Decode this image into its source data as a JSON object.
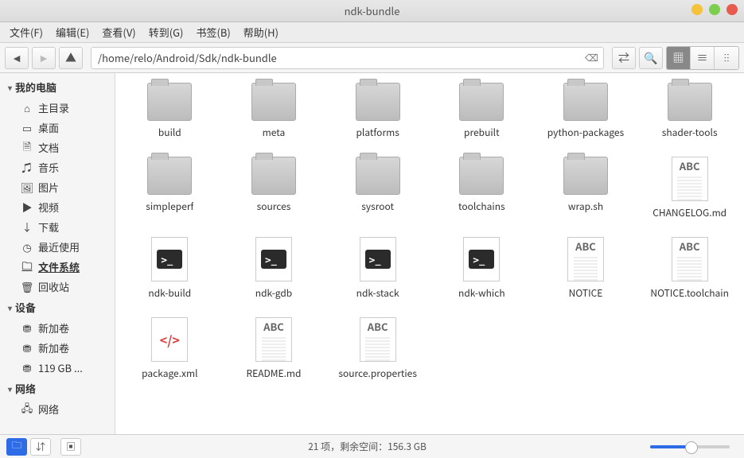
{
  "window": {
    "title": "ndk-bundle"
  },
  "menu": {
    "file": "文件(F)",
    "edit": "编辑(E)",
    "view": "查看(V)",
    "go": "转到(G)",
    "bookmarks": "书签(B)",
    "help": "帮助(H)"
  },
  "toolbar": {
    "path": "/home/relo/Android/Sdk/ndk-bundle"
  },
  "sidebar": {
    "groups": [
      {
        "label": "我的电脑",
        "items": [
          {
            "icon": "home-icon",
            "glyph": "⌂",
            "label": "主目录"
          },
          {
            "icon": "desktop-icon",
            "glyph": "▭",
            "label": "桌面"
          },
          {
            "icon": "documents-icon",
            "glyph": "🗎",
            "label": "文档"
          },
          {
            "icon": "music-icon",
            "glyph": "♫",
            "label": "音乐"
          },
          {
            "icon": "pictures-icon",
            "glyph": "🖼",
            "label": "图片"
          },
          {
            "icon": "videos-icon",
            "glyph": "▶",
            "label": "视频"
          },
          {
            "icon": "downloads-icon",
            "glyph": "↓",
            "label": "下载"
          },
          {
            "icon": "recent-icon",
            "glyph": "◷",
            "label": "最近使用"
          },
          {
            "icon": "filesystem-icon",
            "glyph": "🗀",
            "label": "文件系统",
            "active": true
          },
          {
            "icon": "trash-icon",
            "glyph": "🗑",
            "label": "回收站"
          }
        ]
      },
      {
        "label": "设备",
        "items": [
          {
            "icon": "drive-icon",
            "glyph": "⛃",
            "label": "新加卷"
          },
          {
            "icon": "drive-icon",
            "glyph": "⛃",
            "label": "新加卷"
          },
          {
            "icon": "drive-icon",
            "glyph": "⛃",
            "label": "119 GB ..."
          }
        ]
      },
      {
        "label": "网络",
        "items": [
          {
            "icon": "network-icon",
            "glyph": "🖧",
            "label": "网络"
          }
        ]
      }
    ]
  },
  "files": [
    {
      "name": "build",
      "type": "folder"
    },
    {
      "name": "meta",
      "type": "folder"
    },
    {
      "name": "platforms",
      "type": "folder"
    },
    {
      "name": "prebuilt",
      "type": "folder"
    },
    {
      "name": "python-packages",
      "type": "folder"
    },
    {
      "name": "shader-tools",
      "type": "folder"
    },
    {
      "name": "simpleperf",
      "type": "folder"
    },
    {
      "name": "sources",
      "type": "folder"
    },
    {
      "name": "sysroot",
      "type": "folder"
    },
    {
      "name": "toolchains",
      "type": "folder"
    },
    {
      "name": "wrap.sh",
      "type": "folder"
    },
    {
      "name": "CHANGELOG.md",
      "type": "text"
    },
    {
      "name": "ndk-build",
      "type": "shell"
    },
    {
      "name": "ndk-gdb",
      "type": "shell"
    },
    {
      "name": "ndk-stack",
      "type": "shell"
    },
    {
      "name": "ndk-which",
      "type": "shell"
    },
    {
      "name": "NOTICE",
      "type": "text"
    },
    {
      "name": "NOTICE.toolchain",
      "type": "text"
    },
    {
      "name": "package.xml",
      "type": "xml"
    },
    {
      "name": "README.md",
      "type": "text"
    },
    {
      "name": "source.properties",
      "type": "text"
    }
  ],
  "status": {
    "text": "21 项，剩余空间：156.3 GB"
  }
}
